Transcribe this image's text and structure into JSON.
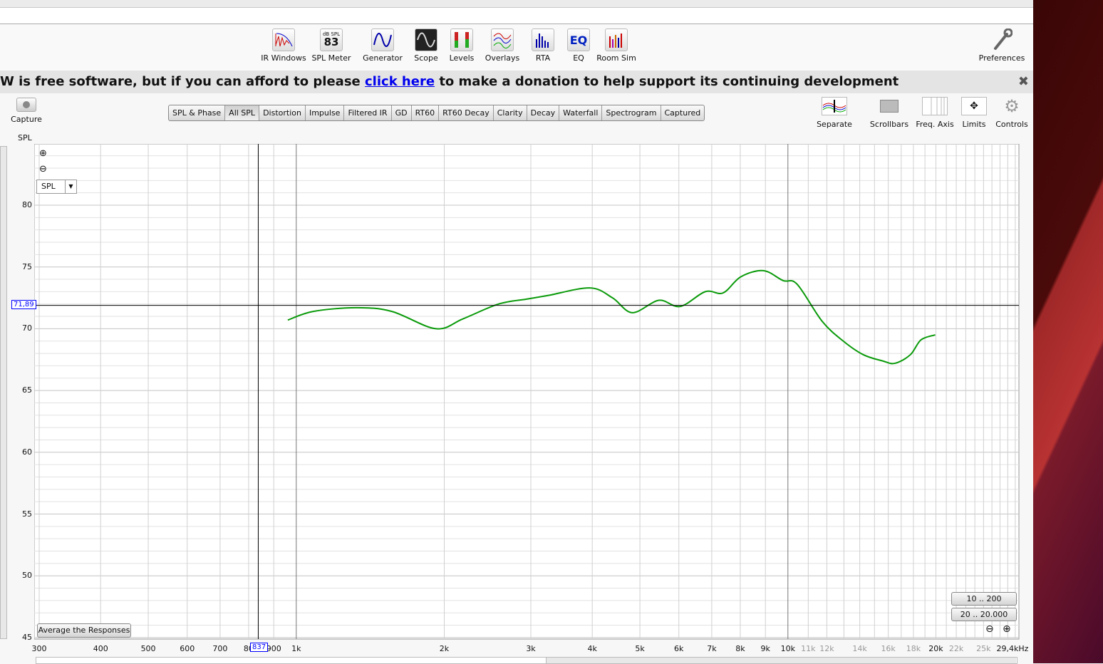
{
  "toolbar": {
    "items": [
      {
        "label": "IR Windows",
        "icon": "ir-windows-icon"
      },
      {
        "label": "SPL Meter",
        "icon": "spl-meter-icon",
        "meter_unit": "dB SPL",
        "meter_value": "83"
      },
      {
        "label": "Generator",
        "icon": "sine-wave-icon"
      },
      {
        "label": "Scope",
        "icon": "scope-icon"
      },
      {
        "label": "Levels",
        "icon": "levels-icon"
      },
      {
        "label": "Overlays",
        "icon": "overlays-icon"
      },
      {
        "label": "RTA",
        "icon": "rta-icon"
      },
      {
        "label": "EQ",
        "icon": "eq-icon",
        "glyph": "EQ"
      },
      {
        "label": "Room Sim",
        "icon": "room-sim-icon"
      }
    ],
    "preferences": "Preferences"
  },
  "banner": {
    "text_before": "W is free software, but if you can afford to please ",
    "link": "click here",
    "text_after": " to make a donation to help support its continuing development",
    "close": "✖"
  },
  "capture": "Capture",
  "tabs": [
    {
      "label": "SPL & Phase",
      "active": false
    },
    {
      "label": "All SPL",
      "active": true
    },
    {
      "label": "Distortion",
      "active": false
    },
    {
      "label": "Impulse",
      "active": false
    },
    {
      "label": "Filtered IR",
      "active": false
    },
    {
      "label": "GD",
      "active": false
    },
    {
      "label": "RT60",
      "active": false
    },
    {
      "label": "RT60 Decay",
      "active": false
    },
    {
      "label": "Clarity",
      "active": false
    },
    {
      "label": "Decay",
      "active": false
    },
    {
      "label": "Waterfall",
      "active": false
    },
    {
      "label": "Spectrogram",
      "active": false
    },
    {
      "label": "Captured",
      "active": false
    }
  ],
  "right_tools": [
    "Separate",
    "Scrollbars",
    "Freq. Axis",
    "Limits",
    "Controls"
  ],
  "graph": {
    "y_unit_label": "SPL",
    "trace_select": "SPL",
    "average_button": "Average the Responses",
    "range_buttons": [
      "10 .. 200",
      "20 .. 20.000"
    ],
    "cursor_y": "71,89",
    "cursor_x": "837"
  },
  "chart_data": {
    "type": "line",
    "ylabel": "SPL",
    "xlim": [
      300,
      29400
    ],
    "ylim": [
      45,
      85
    ],
    "x_scale": "log",
    "grid": true,
    "y_ticks": [
      45,
      50,
      55,
      60,
      65,
      70,
      75,
      80
    ],
    "x_ticks": [
      {
        "f": 300,
        "label": "300"
      },
      {
        "f": 400,
        "label": "400"
      },
      {
        "f": 500,
        "label": "500"
      },
      {
        "f": 600,
        "label": "600"
      },
      {
        "f": 700,
        "label": "700"
      },
      {
        "f": 800,
        "label": "80"
      },
      {
        "f": 900,
        "label": "900"
      },
      {
        "f": 1000,
        "label": "1k"
      },
      {
        "f": 2000,
        "label": "2k"
      },
      {
        "f": 3000,
        "label": "3k"
      },
      {
        "f": 4000,
        "label": "4k"
      },
      {
        "f": 5000,
        "label": "5k"
      },
      {
        "f": 6000,
        "label": "6k"
      },
      {
        "f": 7000,
        "label": "7k"
      },
      {
        "f": 8000,
        "label": "8k"
      },
      {
        "f": 9000,
        "label": "9k"
      },
      {
        "f": 10000,
        "label": "10k"
      },
      {
        "f": 11000,
        "label": "11k",
        "minor": true
      },
      {
        "f": 12000,
        "label": "12k",
        "minor": true
      },
      {
        "f": 14000,
        "label": "14k",
        "minor": true
      },
      {
        "f": 16000,
        "label": "16k",
        "minor": true
      },
      {
        "f": 18000,
        "label": "18k",
        "minor": true
      },
      {
        "f": 20000,
        "label": "20k"
      },
      {
        "f": 22000,
        "label": "22k",
        "minor": true
      },
      {
        "f": 25000,
        "label": "25k",
        "minor": true
      },
      {
        "f": 29400,
        "label": "29,4kHz"
      }
    ],
    "cursor": {
      "f": 837,
      "spl": 71.89
    },
    "series": [
      {
        "color": "#0a9a0a",
        "points": [
          [
            961,
            70.7
          ],
          [
            1083,
            71.4
          ],
          [
            1324,
            71.7
          ],
          [
            1564,
            71.4
          ],
          [
            1923,
            70.0
          ],
          [
            2183,
            70.8
          ],
          [
            2580,
            72.0
          ],
          [
            2947,
            72.4
          ],
          [
            3258,
            72.7
          ],
          [
            3957,
            73.3
          ],
          [
            4397,
            72.5
          ],
          [
            4826,
            71.3
          ],
          [
            5463,
            72.3
          ],
          [
            6037,
            71.8
          ],
          [
            6791,
            73.0
          ],
          [
            7383,
            72.9
          ],
          [
            8017,
            74.2
          ],
          [
            8916,
            74.7
          ],
          [
            9775,
            73.9
          ],
          [
            10440,
            73.6
          ],
          [
            11740,
            70.6
          ],
          [
            12960,
            69.0
          ],
          [
            14230,
            67.9
          ],
          [
            15560,
            67.4
          ],
          [
            16510,
            67.2
          ],
          [
            17750,
            67.9
          ],
          [
            18650,
            69.1
          ],
          [
            19940,
            69.5
          ]
        ]
      }
    ]
  }
}
